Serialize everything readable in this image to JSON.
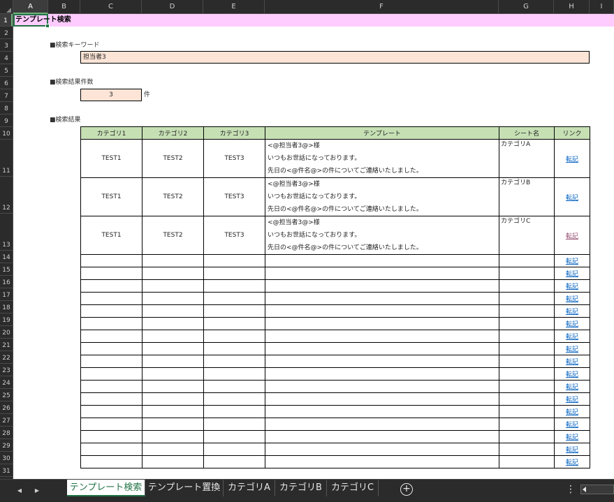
{
  "columns": [
    "A",
    "B",
    "C",
    "D",
    "E",
    "F",
    "G",
    "H",
    "I"
  ],
  "rows": [
    "1",
    "2",
    "3",
    "4",
    "5",
    "6",
    "7",
    "8",
    "9",
    "10",
    "11",
    "12",
    "13",
    "14",
    "15",
    "16",
    "17",
    "18",
    "19",
    "20",
    "21",
    "22",
    "23",
    "24",
    "25",
    "26",
    "27",
    "28",
    "29",
    "30",
    "31"
  ],
  "title": "テンプレート検索",
  "keyword_label": "■検索キーワード",
  "keyword_value": "担当者3",
  "count_label": "■検索結果件数",
  "count_value": "3",
  "count_unit": "件",
  "results_label": "■検索結果",
  "table": {
    "headers": [
      "カテゴリ1",
      "カテゴリ2",
      "カテゴリ3",
      "テンプレート",
      "シート名",
      "リンク"
    ],
    "rows": [
      {
        "cat1": "TEST1",
        "cat2": "TEST2",
        "cat3": "TEST3",
        "line1": "<@担当者3@>様",
        "line2": "いつもお世話になっております。",
        "line3": "先日の<@件名@>の件についてご連絡いたしました。",
        "sheet": "カテゴリA",
        "link": "転記",
        "visited": false
      },
      {
        "cat1": "TEST1",
        "cat2": "TEST2",
        "cat3": "TEST3",
        "line1": "<@担当者3@>様",
        "line2": "いつもお世話になっております。",
        "line3": "先日の<@件名@>の件についてご連絡いたしました。",
        "sheet": "カテゴリB",
        "link": "転記",
        "visited": false
      },
      {
        "cat1": "TEST1",
        "cat2": "TEST2",
        "cat3": "TEST3",
        "line1": "<@担当者3@>様",
        "line2": "いつもお世話になっております。",
        "line3": "先日の<@件名@>の件についてご連絡いたしました。",
        "sheet": "カテゴリC",
        "link": "転記",
        "visited": true
      }
    ],
    "empty_link": "転記",
    "empty_rows": 17
  },
  "sheet_tabs": [
    "テンプレート検索",
    "テンプレート置換",
    "カテゴリA",
    "カテゴリB",
    "カテゴリC"
  ],
  "active_tab": "テンプレート検索",
  "colors": {
    "title_band": "#ffccff",
    "input_fill": "#fce4d6",
    "header_fill": "#c6e0b4",
    "selection": "#217346",
    "link": "#0563c1",
    "visited_link": "#954f72"
  }
}
